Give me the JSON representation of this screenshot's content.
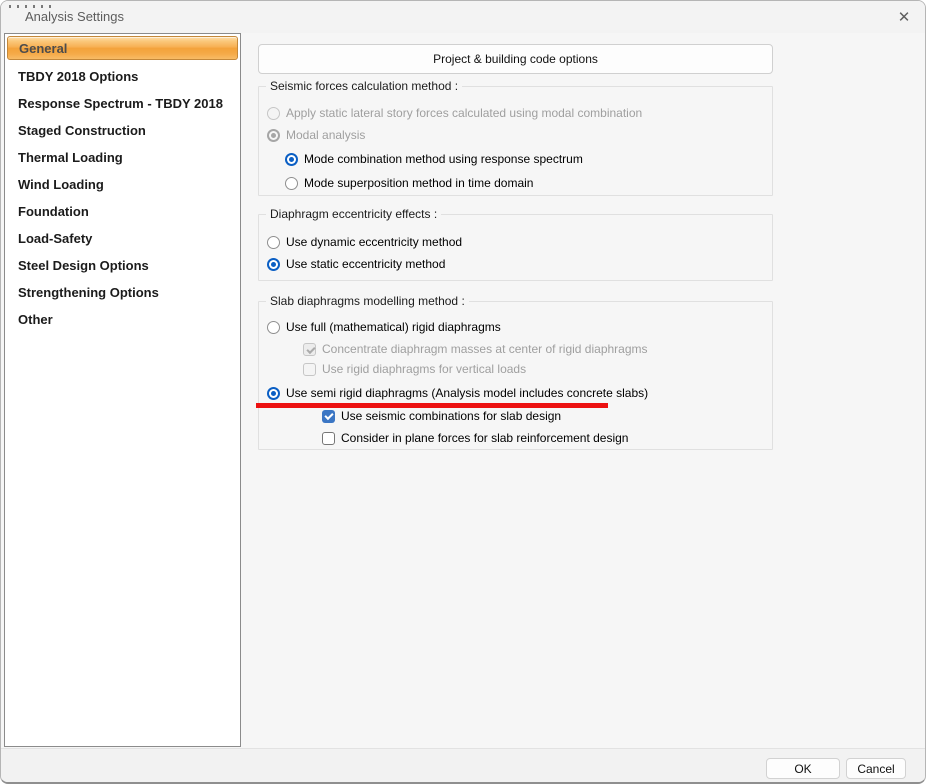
{
  "window": {
    "title": "Analysis Settings",
    "close_glyph": "✕"
  },
  "colors": {
    "accent_radio_blue": "#0b5fc4",
    "checkbox_blue": "#3b76c4",
    "selected_item_orange": "#f3a23a",
    "selected_item_border": "#c4883a",
    "annotation_red": "#ec1111"
  },
  "sidebar": {
    "items": [
      {
        "label": "General",
        "selected": true
      },
      {
        "label": "TBDY 2018 Options",
        "selected": false
      },
      {
        "label": "Response Spectrum - TBDY 2018",
        "selected": false
      },
      {
        "label": "Staged Construction",
        "selected": false
      },
      {
        "label": "Thermal Loading",
        "selected": false
      },
      {
        "label": "Wind Loading",
        "selected": false
      },
      {
        "label": "Foundation",
        "selected": false
      },
      {
        "label": "Load-Safety",
        "selected": false
      },
      {
        "label": "Steel Design Options",
        "selected": false
      },
      {
        "label": "Strengthening Options",
        "selected": false
      },
      {
        "label": "Other",
        "selected": false
      }
    ]
  },
  "main": {
    "project_button_label": "Project & building code options",
    "seismic_group": {
      "title": "Seismic forces calculation method :",
      "options": [
        {
          "label": "Apply static lateral story forces calculated using modal combination",
          "control": "radio",
          "state": "disabled",
          "checked": false
        },
        {
          "label": "Modal analysis",
          "control": "radio",
          "state": "disabled",
          "checked": true
        },
        {
          "label": "Mode combination method using response spectrum",
          "control": "radio",
          "state": "enabled",
          "checked": true
        },
        {
          "label": "Mode superposition method in time domain",
          "control": "radio",
          "state": "enabled",
          "checked": false
        }
      ]
    },
    "eccentricity_group": {
      "title": "Diaphragm eccentricity effects :",
      "options": [
        {
          "label": "Use dynamic eccentricity method",
          "control": "radio",
          "state": "enabled",
          "checked": false
        },
        {
          "label": "Use static eccentricity method",
          "control": "radio",
          "state": "enabled",
          "checked": true
        }
      ]
    },
    "slab_group": {
      "title": "Slab diaphragms modelling method :",
      "options": [
        {
          "label": "Use full (mathematical) rigid diaphragms",
          "control": "radio",
          "state": "enabled",
          "checked": false
        },
        {
          "label": "Concentrate diaphragm masses at center of rigid diaphragms",
          "control": "checkbox",
          "state": "disabled",
          "checked": true
        },
        {
          "label": "Use rigid diaphragms for vertical loads",
          "control": "checkbox",
          "state": "disabled",
          "checked": false
        },
        {
          "label": "Use semi rigid diaphragms (Analysis model includes concrete slabs)",
          "control": "radio",
          "state": "enabled",
          "checked": true,
          "annotated": true
        },
        {
          "label": "Use seismic combinations for slab design",
          "control": "checkbox",
          "state": "enabled",
          "checked": true
        },
        {
          "label": "Consider in plane forces for slab reinforcement design",
          "control": "checkbox",
          "state": "enabled",
          "checked": false
        }
      ]
    }
  },
  "footer": {
    "ok_label": "OK",
    "cancel_label": "Cancel"
  }
}
